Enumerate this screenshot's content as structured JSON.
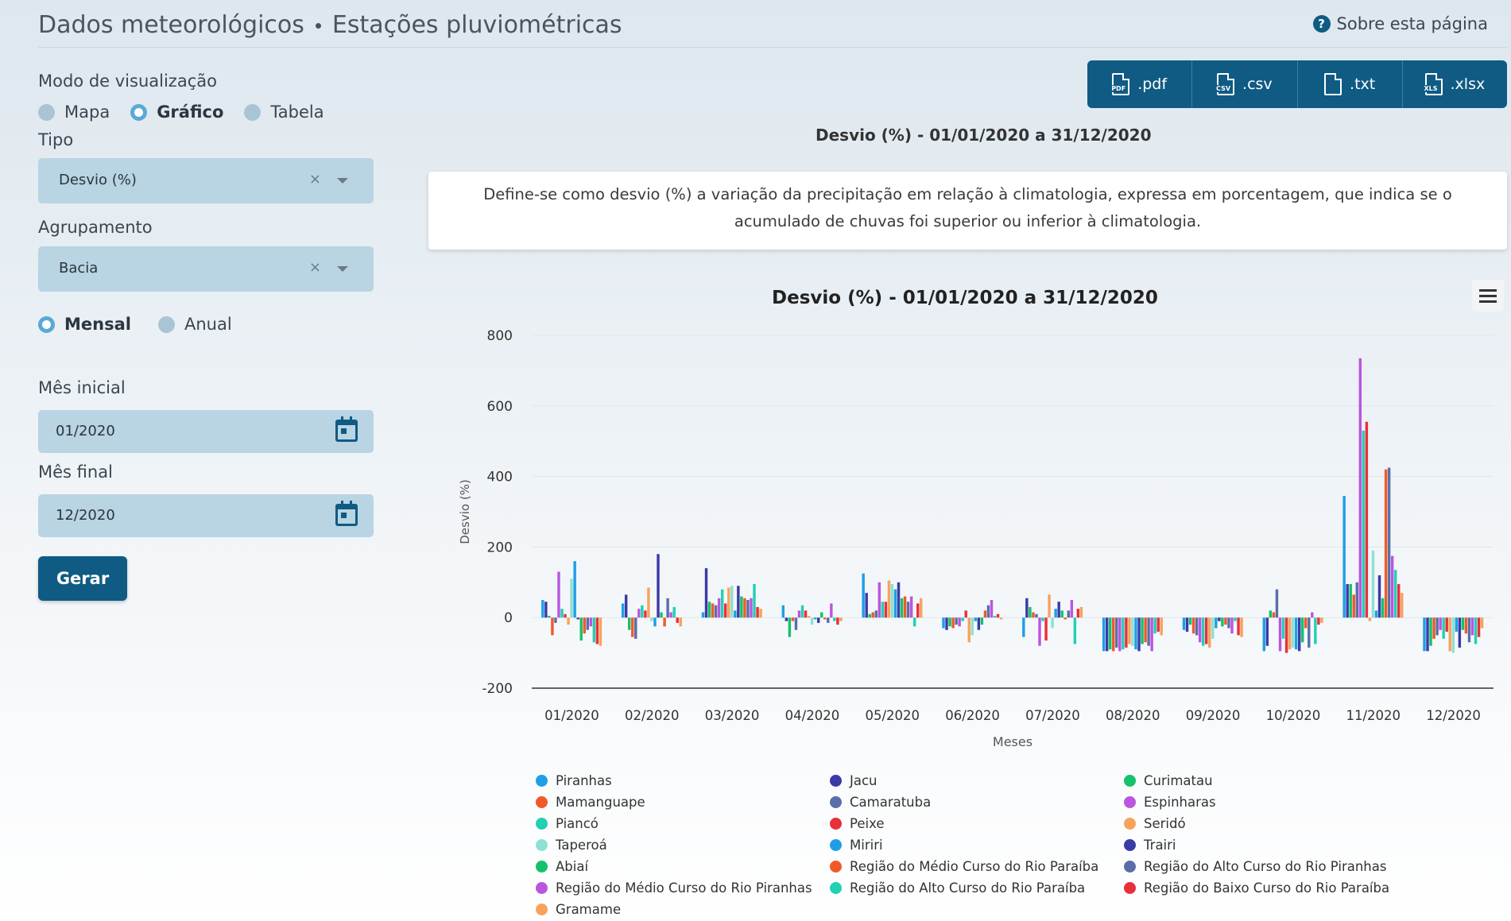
{
  "header": {
    "breadcrumb_main": "Dados meteorológicos",
    "breadcrumb_sub": "Estações pluviométricas",
    "about_label": "Sobre esta página"
  },
  "sidebar": {
    "view_mode_label": "Modo de visualização",
    "view_modes": [
      "Mapa",
      "Gráfico",
      "Tabela"
    ],
    "view_mode_selected": "Gráfico",
    "type_label": "Tipo",
    "type_value": "Desvio (%)",
    "group_label": "Agrupamento",
    "group_value": "Bacia",
    "periodicity": [
      "Mensal",
      "Anual"
    ],
    "periodicity_selected": "Mensal",
    "start_label": "Mês inicial",
    "start_value": "01/2020",
    "end_label": "Mês final",
    "end_value": "12/2020",
    "generate_label": "Gerar"
  },
  "export": [
    ".pdf",
    ".csv",
    ".txt",
    ".xlsx"
  ],
  "export_icon_labels": [
    "PDF",
    "CSV",
    "",
    "XLS"
  ],
  "subtitle": "Desvio (%) - 01/01/2020 a 31/12/2020",
  "note": "Define-se como desvio (%) a variação da precipitação em relação à climatologia, expressa em porcentagem, que indica se o acumulado de chuvas foi superior ou inferior à climatologia.",
  "chart_data": {
    "type": "bar",
    "title": "Desvio (%) - 01/01/2020 a 31/12/2020",
    "xlabel": "Meses",
    "ylabel": "Desvio (%)",
    "ylim": [
      -200,
      800
    ],
    "yticks": [
      800,
      600,
      400,
      200,
      0,
      -200
    ],
    "grid": true,
    "legend_position": "bottom",
    "categories": [
      "01/2020",
      "02/2020",
      "03/2020",
      "04/2020",
      "05/2020",
      "06/2020",
      "07/2020",
      "08/2020",
      "09/2020",
      "10/2020",
      "11/2020",
      "12/2020"
    ],
    "series": [
      {
        "name": "Piranhas",
        "color": "#1f9ee6",
        "values": [
          50,
          40,
          15,
          35,
          125,
          -30,
          -55,
          -95,
          -35,
          -95,
          345,
          -95
        ]
      },
      {
        "name": "Jacu",
        "color": "#3a3aa8",
        "values": [
          45,
          65,
          140,
          -10,
          70,
          -35,
          55,
          -95,
          -40,
          -80,
          95,
          -95
        ]
      },
      {
        "name": "Curimatau",
        "color": "#14c26a",
        "values": [
          5,
          -35,
          45,
          -55,
          10,
          -25,
          30,
          -90,
          -20,
          20,
          95,
          -80
        ]
      },
      {
        "name": "Mamanguape",
        "color": "#f05a28",
        "values": [
          -50,
          -55,
          40,
          -10,
          15,
          -30,
          15,
          -95,
          -45,
          15,
          65,
          -60
        ]
      },
      {
        "name": "Camaratuba",
        "color": "#5a6fa8",
        "values": [
          -15,
          -60,
          35,
          -35,
          20,
          -20,
          10,
          -85,
          -50,
          80,
          100,
          -50
        ]
      },
      {
        "name": "Espinharas",
        "color": "#bb55e0",
        "values": [
          130,
          25,
          55,
          20,
          100,
          -25,
          -80,
          -95,
          -70,
          -95,
          735,
          -35
        ]
      },
      {
        "name": "Piancó",
        "color": "#22d0b4",
        "values": [
          25,
          35,
          80,
          35,
          45,
          -10,
          -10,
          -90,
          -80,
          -60,
          530,
          -60
        ]
      },
      {
        "name": "Peixe",
        "color": "#e8303a",
        "values": [
          10,
          20,
          40,
          20,
          45,
          20,
          -65,
          -85,
          -75,
          -100,
          555,
          -40
        ]
      },
      {
        "name": "Seridó",
        "color": "#f7a35c",
        "values": [
          -20,
          85,
          85,
          5,
          105,
          -70,
          65,
          -75,
          -85,
          -90,
          -10,
          -95
        ]
      },
      {
        "name": "Taperoá",
        "color": "#8fe0d0",
        "values": [
          110,
          -10,
          90,
          -20,
          95,
          -50,
          -30,
          -80,
          -60,
          -85,
          190,
          -100
        ]
      },
      {
        "name": "Miriri",
        "color": "#1f9ee6",
        "values": [
          160,
          -25,
          20,
          -5,
          80,
          -10,
          25,
          -90,
          -30,
          -90,
          20,
          -40
        ]
      },
      {
        "name": "Trairi",
        "color": "#3a3aa8",
        "values": [
          -5,
          180,
          90,
          -15,
          100,
          -35,
          45,
          -95,
          -10,
          -95,
          120,
          -85
        ]
      },
      {
        "name": "Abiaí",
        "color": "#14c26a",
        "values": [
          -65,
          15,
          60,
          15,
          55,
          -20,
          20,
          -75,
          -25,
          -70,
          55,
          -35
        ]
      },
      {
        "name": "Região do Médio Curso do Rio Paraíba",
        "color": "#f05a28",
        "values": [
          -45,
          -25,
          55,
          -5,
          60,
          20,
          -5,
          -70,
          -20,
          -30,
          420,
          -45
        ]
      },
      {
        "name": "Região do Alto Curso do Rio Piranhas",
        "color": "#5a6fa8",
        "values": [
          -35,
          55,
          50,
          -15,
          45,
          35,
          20,
          -80,
          -30,
          -85,
          425,
          -70
        ]
      },
      {
        "name": "Região do Médio Curso do Rio Piranhas",
        "color": "#bb55e0",
        "values": [
          -25,
          15,
          55,
          40,
          60,
          50,
          50,
          -95,
          -45,
          15,
          175,
          -50
        ]
      },
      {
        "name": "Região do Alto Curso do Rio Paraíba",
        "color": "#22d0b4",
        "values": [
          -70,
          30,
          95,
          -10,
          -25,
          5,
          -75,
          -45,
          -10,
          -75,
          135,
          -75
        ]
      },
      {
        "name": "Região do Baixo Curso do Rio Paraíba",
        "color": "#e8303a",
        "values": [
          -75,
          -15,
          30,
          -20,
          40,
          10,
          25,
          -40,
          -50,
          -20,
          95,
          -55
        ]
      },
      {
        "name": "Gramame",
        "color": "#f7a35c",
        "values": [
          -80,
          -25,
          25,
          -10,
          55,
          -5,
          30,
          -50,
          -55,
          -15,
          70,
          -30
        ]
      }
    ]
  }
}
